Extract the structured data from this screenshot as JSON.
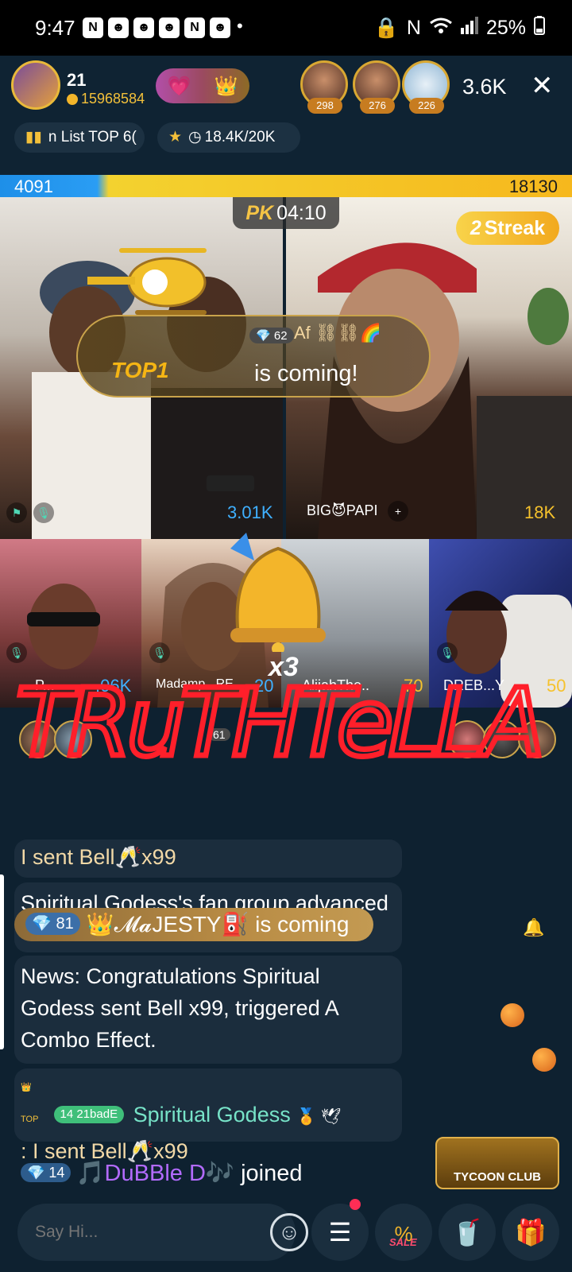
{
  "status_bar": {
    "time": "9:47",
    "battery": "25%",
    "notif_icons": [
      "N",
      "☻",
      "☻",
      "☻",
      "N",
      "☻"
    ]
  },
  "header": {
    "host_level": "21",
    "host_coins": "15968584",
    "viewers": [
      {
        "badge": "298"
      },
      {
        "badge": "276"
      },
      {
        "badge": "226"
      }
    ],
    "viewer_count": "3.6K",
    "close": "✕",
    "rank_pill": "n List TOP 6(",
    "gift_pill": "18.4K/20K"
  },
  "pk": {
    "left_score": "4091",
    "right_score": "18130",
    "label": "PK",
    "timer": "04:10",
    "streak_num": "2",
    "streak_label": "Streak"
  },
  "banner": {
    "level": "62",
    "user": "Af ⛓⛓🌈",
    "message": "is coming!",
    "rank": "TOP1"
  },
  "cells": {
    "left_score": "3.01K",
    "right_name": "BIG😈PAPI",
    "right_score": "18K",
    "s1_name": "P...",
    "s1_score": ".06K",
    "s2_name": "Madamp...RE...",
    "s2_score": "20",
    "s3_name": "AlijahThe..",
    "s3_score": "70",
    "s4_name": "DREB...Y",
    "s4_score": "50",
    "combo": "x3",
    "small_level": "61"
  },
  "watermark": "TRuTHTeLLA",
  "chat": {
    "m1": "I sent Bell🥂x99",
    "m2": "Spiritual Godess's fan group advanced to lv.4.",
    "majesty_level": "81",
    "majesty_text": "👑𝓜𝓪JESTY⛽ is coming",
    "news": "News: Congratulations Spiritual Godess sent Bell x99, triggered A Combo Effect.",
    "sender_top": "TOP",
    "sender_level": "14",
    "sender_badge": "21badE",
    "sender_name": "Spiritual Godess",
    "sender_text": ": I sent Bell🥂x99",
    "joined_level": "14",
    "joined_name": "🎵DuBBle D🎶",
    "joined_text": "joined"
  },
  "tycoon": "TYCOON CLUB",
  "bottom": {
    "placeholder": "Say Hi...",
    "emoji": "☺",
    "menu": "☰",
    "sale": "SALE",
    "drink": "🥤",
    "gift": "🎁"
  }
}
